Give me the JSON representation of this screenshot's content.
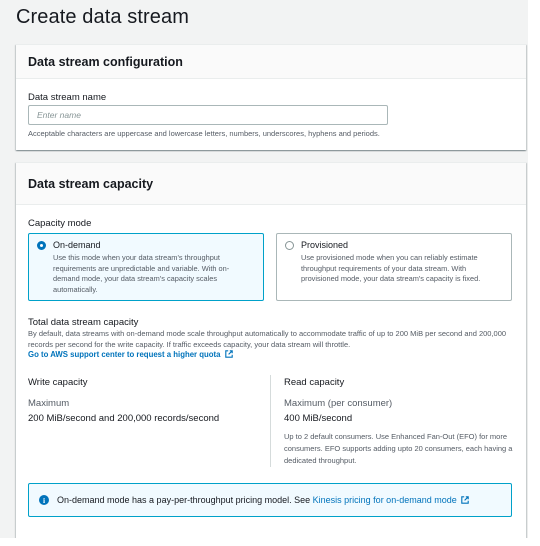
{
  "page": {
    "title": "Create data stream"
  },
  "config_section": {
    "heading": "Data stream configuration",
    "name_label": "Data stream name",
    "name_placeholder": "Enter name",
    "name_hint": "Acceptable characters are uppercase and lowercase letters, numbers, underscores, hyphens and periods."
  },
  "capacity_section": {
    "heading": "Data stream capacity",
    "mode_label": "Capacity mode",
    "options": [
      {
        "label": "On-demand",
        "description": "Use this mode when your data stream's throughput requirements are unpredictable and variable. With on-demand mode, your data stream's capacity scales automatically.",
        "selected": true
      },
      {
        "label": "Provisioned",
        "description": "Use provisioned mode when you can reliably estimate throughput requirements of your data stream. With provisioned mode, your data stream's capacity is fixed.",
        "selected": false
      }
    ],
    "total_label": "Total data stream capacity",
    "total_description": "By default, data streams with on-demand mode scale throughput automatically to accommodate traffic of up to 200 MiB per second and 200,000 records per second for the write capacity. If traffic exceeds capacity, your data stream will throttle.",
    "support_link": "Go to AWS support center to request a higher quota",
    "write": {
      "heading": "Write capacity",
      "max_label": "Maximum",
      "max_value": "200 MiB/second and 200,000 records/second"
    },
    "read": {
      "heading": "Read capacity",
      "max_label": "Maximum (per consumer)",
      "max_value": "400 MiB/second",
      "note": "Up to 2 default consumers. Use Enhanced Fan-Out (EFO) for more consumers. EFO supports adding upto 20 consumers, each having a dedicated throughput."
    },
    "info_text": "On-demand mode has a pay-per-throughput pricing model. See ",
    "info_link": "Kinesis pricing for on-demand mode"
  },
  "colors": {
    "accent": "#0073bb",
    "selected_border": "#00a1c9",
    "selected_bg": "#f1faff",
    "page_bg": "#f2f3f3"
  }
}
